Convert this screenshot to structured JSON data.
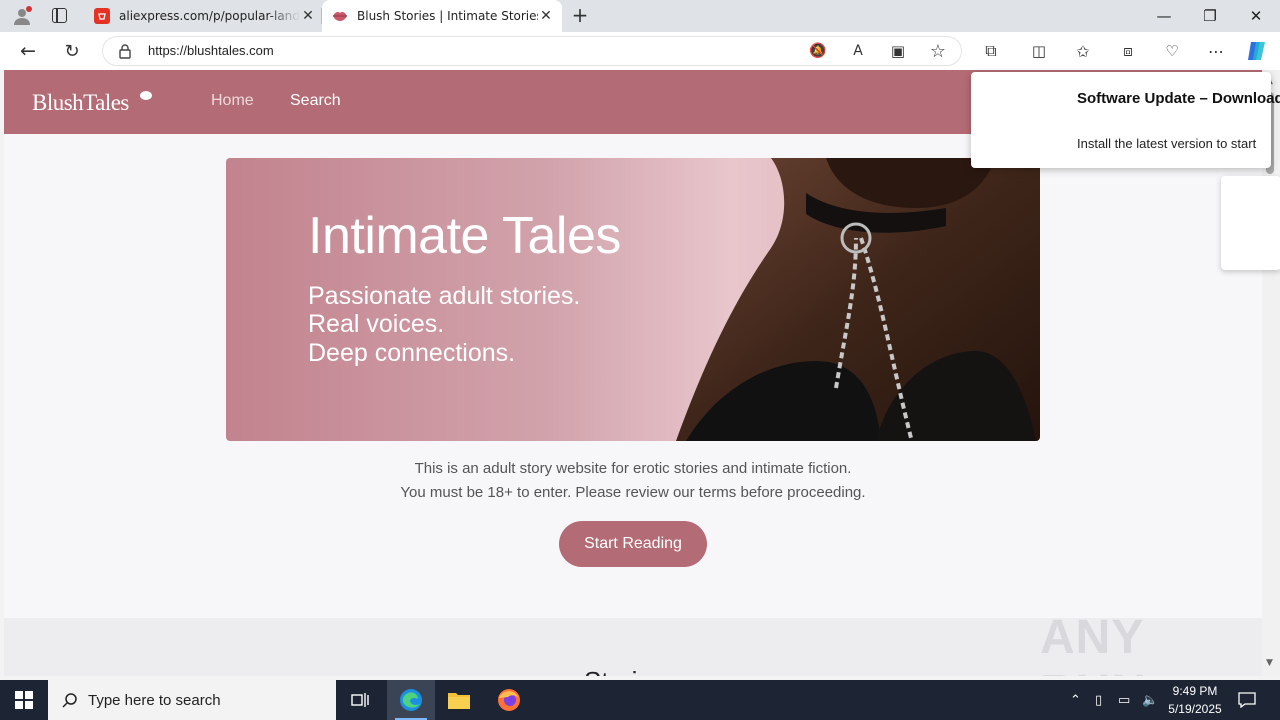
{
  "browser": {
    "tabs": [
      {
        "title": "aliexpress.com/p/popular-landing",
        "active": false
      },
      {
        "title": "Blush Stories | Intimate Stories",
        "active": true
      }
    ],
    "url": "https://blushtales.com",
    "new_tab_label": "+"
  },
  "site": {
    "logo": "BlushTales",
    "nav": {
      "home": "Home",
      "search": "Search"
    },
    "hero": {
      "title": "Intimate Tales",
      "lines": [
        "Passionate adult stories.",
        "Real voices.",
        "Deep connections."
      ]
    },
    "intro": [
      "This is an adult story website for erotic stories and intimate fiction.",
      "You must be 18+ to enter. Please review our terms before proceeding."
    ],
    "cta": "Start Reading",
    "stories_heading": "Stories",
    "accent_color": "#b36b75"
  },
  "notification": {
    "title": "Software Update – Download",
    "body": "Install the latest version to start"
  },
  "watermark": "ANY RUN",
  "taskbar": {
    "search_placeholder": "Type here to search",
    "time": "9:49 PM",
    "date": "5/19/2025"
  }
}
